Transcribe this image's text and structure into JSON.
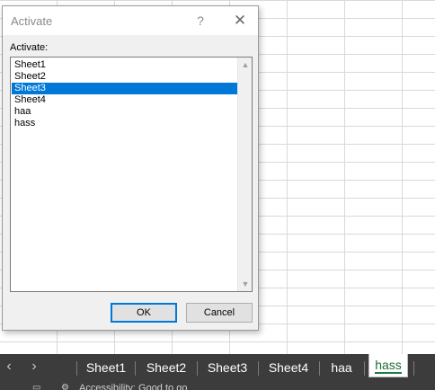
{
  "dialog": {
    "title": "Activate",
    "help": "?",
    "close": "✕",
    "list_label": "Activate:",
    "items": [
      "Sheet1",
      "Sheet2",
      "Sheet3",
      "Sheet4",
      "haa",
      "hass"
    ],
    "selected_index": 2,
    "scroll_up": "▲",
    "scroll_down": "▼",
    "ok_label": "OK",
    "cancel_label": "Cancel"
  },
  "tabbar": {
    "prev_arrow": "‹",
    "next_arrow": "›",
    "tabs": [
      "Sheet1",
      "Sheet2",
      "Sheet3",
      "Sheet4",
      "haa",
      "hass"
    ],
    "active_tab": "hass"
  },
  "statusbar": {
    "text": "Accessibility: Good to go",
    "icons": [
      "sheet-view-icon",
      "accessibility-icon"
    ]
  },
  "colors": {
    "selection": "#0078d7",
    "tabbar_bg": "#3c3c3c",
    "active_tab_accent": "#1f7a45"
  }
}
